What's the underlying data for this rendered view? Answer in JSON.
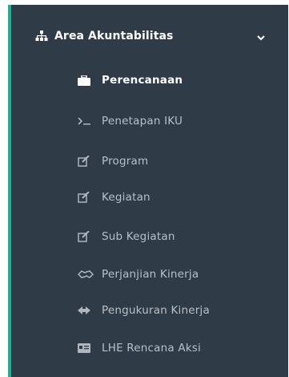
{
  "colors": {
    "sidebar_bg": "#2f3b47",
    "accent": "#1fae95",
    "text_active": "#ffffff",
    "text_muted": "#b7c0c8"
  },
  "menu": {
    "group_label": "Area Akuntabilitas",
    "group_icon": "sitemap-icon",
    "items": [
      {
        "label": "Perencanaan",
        "icon": "briefcase-icon",
        "active": true
      },
      {
        "label": "Penetapan IKU",
        "icon": "terminal-icon",
        "active": false
      },
      {
        "label": "Program",
        "icon": "edit-icon",
        "active": false
      },
      {
        "label": "Kegiatan",
        "icon": "edit-icon",
        "active": false
      },
      {
        "label": "Sub Kegiatan",
        "icon": "edit-icon",
        "active": false
      },
      {
        "label": "Perjanjian Kinerja",
        "icon": "handshake-icon",
        "active": false
      },
      {
        "label": "Pengukuran Kinerja",
        "icon": "arrows-icon",
        "active": false
      },
      {
        "label": "LHE Rencana Aksi",
        "icon": "id-card-icon",
        "active": false
      }
    ]
  }
}
